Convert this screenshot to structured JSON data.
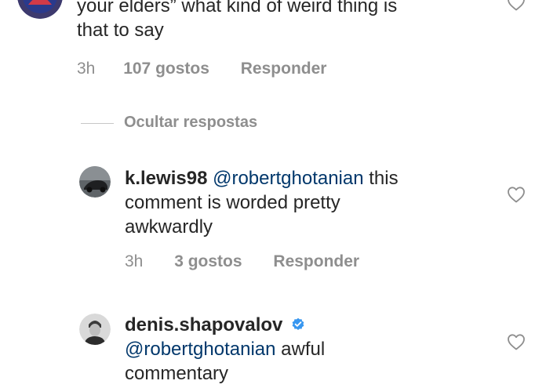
{
  "comments": [
    {
      "text_line1": "your elders” what kind of weird thing is",
      "text_line2": "that to say",
      "time": "3h",
      "likes": "107 gostos",
      "reply": "Responder"
    },
    {
      "username": "k.lewis98",
      "mention": "@robertghotanian",
      "text_line1_rest": " this",
      "text_line2": "comment is worded pretty",
      "text_line3": "awkwardly",
      "time": "3h",
      "likes": "3 gostos",
      "reply": "Responder"
    },
    {
      "username": "denis.shapovalov",
      "mention": "@robertghotanian",
      "text_line2_rest": " awful",
      "text_line3": "commentary"
    }
  ],
  "hide_replies_label": "Ocultar respostas",
  "colors": {
    "text": "#262626",
    "secondary": "#8e8e8e",
    "mention": "#00376b",
    "verified": "#3897f0"
  },
  "icons": {
    "like": "heart-outline-icon",
    "verified": "verified-badge-icon"
  }
}
